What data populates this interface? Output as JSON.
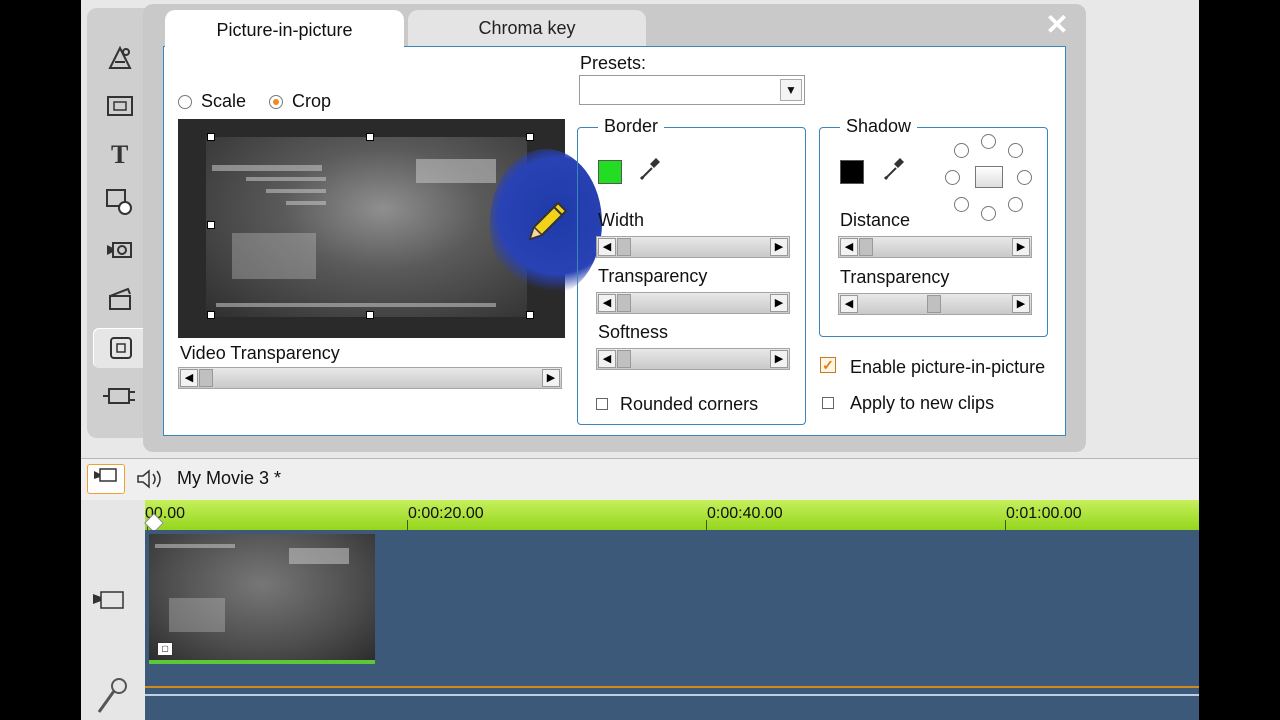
{
  "tabs": [
    {
      "label": "Picture-in-picture",
      "active": true
    },
    {
      "label": "Chroma key",
      "active": false
    }
  ],
  "close_icon": "✕",
  "left_toolbar": [
    {
      "icon": "transitions-icon",
      "glyph": "⚛"
    },
    {
      "icon": "picture-icon",
      "glyph": "▣"
    },
    {
      "icon": "title-icon",
      "glyph": "T"
    },
    {
      "icon": "disc-menu-icon",
      "glyph": "⚙"
    },
    {
      "icon": "camera-effects-icon",
      "glyph": "◉"
    },
    {
      "icon": "clapper-icon",
      "glyph": "🎬"
    },
    {
      "icon": "pip-icon",
      "glyph": "▢",
      "active": true
    },
    {
      "icon": "plugin-icon",
      "glyph": "⊟"
    }
  ],
  "mode": {
    "scale_label": "Scale",
    "crop_label": "Crop",
    "selected": "Crop"
  },
  "video_transparency": {
    "label": "Video Transparency",
    "value": 0
  },
  "presets": {
    "label": "Presets:",
    "value": ""
  },
  "border": {
    "title": "Border",
    "color": "#22dd22",
    "width_label": "Width",
    "transparency_label": "Transparency",
    "softness_label": "Softness",
    "rounded_label": "Rounded corners",
    "rounded_checked": false
  },
  "shadow": {
    "title": "Shadow",
    "color": "#000000",
    "distance_label": "Distance",
    "transparency_label": "Transparency",
    "transparency_value": 0.5
  },
  "options": {
    "enable_label": "Enable picture-in-picture",
    "enable_checked": true,
    "apply_label": "Apply to new clips",
    "apply_checked": false
  },
  "timeline": {
    "movie_title": "My Movie 3 *",
    "ruler_labels": [
      "00.00",
      "0:00:20.00",
      "0:00:40.00",
      "0:01:00.00"
    ]
  },
  "colors": {
    "accent": "#3b86b8",
    "ruler": "#a8dd2e",
    "track": "#3c5979",
    "radio_on": "#f08a1c"
  }
}
